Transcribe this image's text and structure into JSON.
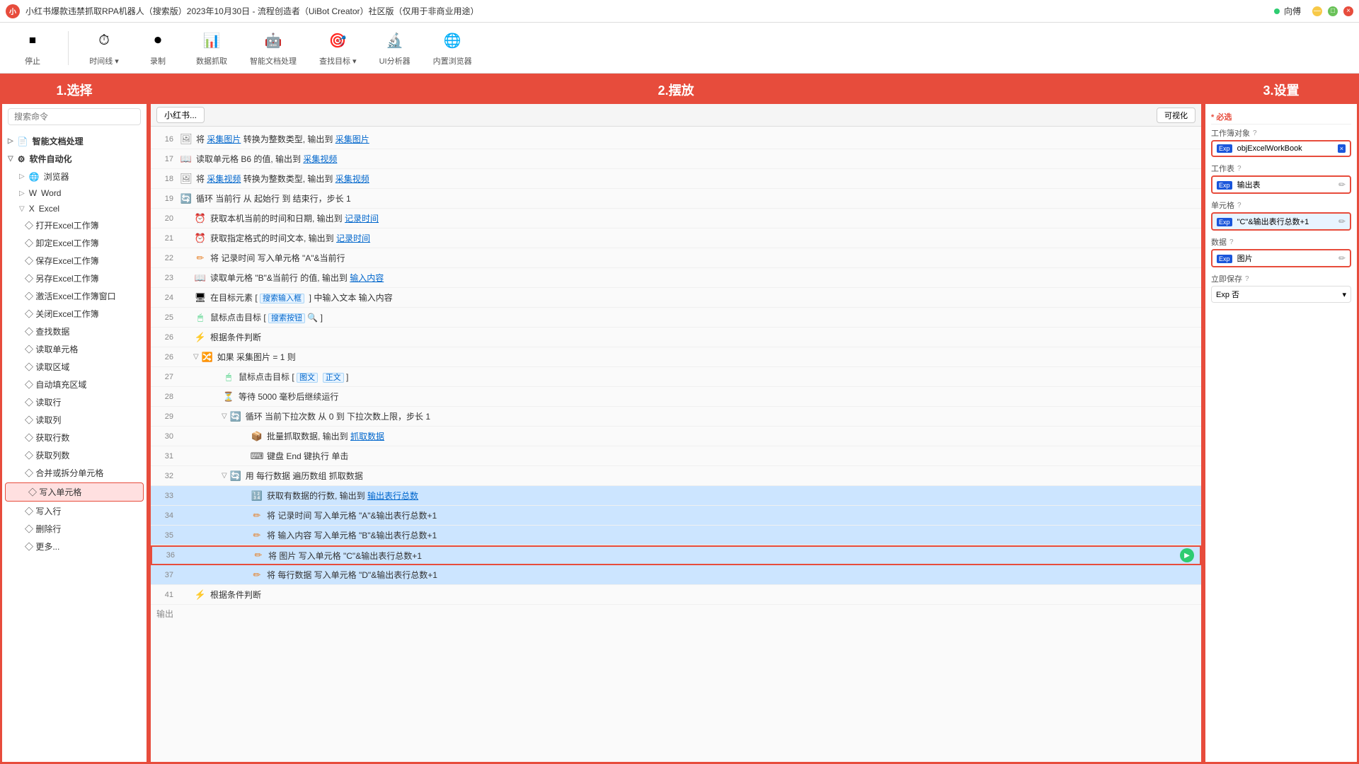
{
  "titleBar": {
    "icon": "小",
    "title": "小红书爆款违禁抓取RPA机器人（搜索版）2023年10月30日 - 流程创造者（UiBot Creator）社区版（仅用于非商业用途）",
    "user": "向傅",
    "windowControls": [
      "minimize",
      "maximize",
      "close"
    ]
  },
  "toolbar": {
    "buttons": [
      {
        "id": "stop",
        "icon": "⏹",
        "label": "停止"
      },
      {
        "id": "timeline",
        "icon": "⏱",
        "label": "时间线 ▾"
      },
      {
        "id": "record",
        "icon": "⏺",
        "label": "录制"
      },
      {
        "id": "dataExtract",
        "icon": "📊",
        "label": "数据抓取"
      },
      {
        "id": "aiDoc",
        "icon": "🤖",
        "label": "智能文档处理"
      },
      {
        "id": "findTarget",
        "icon": "🔍",
        "label": "查找目标 ▾"
      },
      {
        "id": "uiAnalyzer",
        "icon": "🔬",
        "label": "UI分析器"
      },
      {
        "id": "builtinBrowser",
        "icon": "🌐",
        "label": "内置浏览器"
      }
    ]
  },
  "panels": {
    "left": {
      "header": "1.选择",
      "searchPlaceholder": "搜索命令",
      "tree": [
        {
          "id": "智能文档处理",
          "label": "智能文档处理",
          "level": 1,
          "expanded": false,
          "icon": "📄"
        },
        {
          "id": "软件自动化",
          "label": "软件自动化",
          "level": 1,
          "expanded": true,
          "icon": "⚙"
        },
        {
          "id": "浏览器",
          "label": "浏览器",
          "level": 2,
          "expanded": false,
          "icon": "🌐"
        },
        {
          "id": "Word",
          "label": "Word",
          "level": 2,
          "expanded": false,
          "icon": "W"
        },
        {
          "id": "Excel",
          "label": "Excel",
          "level": 2,
          "expanded": true,
          "icon": "X"
        },
        {
          "id": "打开Excel工作簿",
          "label": "打开Excel工作簿",
          "level": 3
        },
        {
          "id": "卸定Excel工作簿",
          "label": "卸定Excel工作簿",
          "level": 3
        },
        {
          "id": "保存Excel工作簿",
          "label": "保存Excel工作簿",
          "level": 3
        },
        {
          "id": "另存Excel工作簿",
          "label": "另存Excel工作簿",
          "level": 3
        },
        {
          "id": "激活Excel工作簿窗口",
          "label": "激活Excel工作簿窗口",
          "level": 3
        },
        {
          "id": "关闭Excel工作簿",
          "label": "关闭Excel工作簿",
          "level": 3
        },
        {
          "id": "查找数据",
          "label": "查找数据",
          "level": 3
        },
        {
          "id": "读取单元格",
          "label": "读取单元格",
          "level": 3
        },
        {
          "id": "读取区域",
          "label": "读取区域",
          "level": 3
        },
        {
          "id": "自动填充区域",
          "label": "自动填充区域",
          "level": 3
        },
        {
          "id": "读取行",
          "label": "读取行",
          "level": 3
        },
        {
          "id": "读取列",
          "label": "读取列",
          "level": 3
        },
        {
          "id": "获取行数",
          "label": "获取行数",
          "level": 3
        },
        {
          "id": "获取列数",
          "label": "获取列数",
          "level": 3
        },
        {
          "id": "合并或拆分单元格",
          "label": "合并或拆分单元格",
          "level": 3
        },
        {
          "id": "写入单元格",
          "label": "写入单元格",
          "level": 3,
          "selected": true
        },
        {
          "id": "写入行",
          "label": "写入行",
          "level": 3
        },
        {
          "id": "删除行",
          "label": "删除行",
          "level": 3
        },
        {
          "id": "更多",
          "label": "更多",
          "level": 3
        }
      ]
    },
    "center": {
      "header": "2.摆放",
      "tabLabel": "小红书...",
      "visibleBtn": "可视化",
      "flowRows": [
        {
          "line": 16,
          "indent": 0,
          "icon": "img",
          "text": "将 采集图片 转换为整数类型, 输出到",
          "highlight": "采集图片",
          "type": "normal"
        },
        {
          "line": 17,
          "indent": 0,
          "icon": "read",
          "text": "读取单元格 B6 的值, 输出到",
          "highlight": "采集视频",
          "type": "normal"
        },
        {
          "line": 18,
          "indent": 0,
          "icon": "img",
          "text": "将 采集视频 转换为整数类型, 输出到",
          "highlight": "采集视频",
          "type": "normal"
        },
        {
          "line": 19,
          "indent": 0,
          "icon": "loop",
          "text": "循环 当前行 从 起始行 到 结束行，步长 1",
          "type": "loop"
        },
        {
          "line": 20,
          "indent": 1,
          "icon": "time",
          "text": "获取本机当前的时间和日期, 输出到",
          "highlight": "记录时间",
          "type": "normal"
        },
        {
          "line": 21,
          "indent": 1,
          "icon": "time",
          "text": "获取指定格式的时间文本, 输出到",
          "highlight": "记录时间",
          "type": "normal"
        },
        {
          "line": 22,
          "indent": 1,
          "icon": "write",
          "text": "将 记录时间 写入单元格 \"A\"&当前行",
          "type": "normal"
        },
        {
          "line": 23,
          "indent": 1,
          "icon": "read",
          "text": "读取单元格 \"B\"&当前行 的值, 输出到",
          "highlight": "输入内容",
          "type": "normal"
        },
        {
          "line": 24,
          "indent": 1,
          "icon": "square",
          "text": "在目标元素 [ 搜索输入框 ] 中输入文本 输入内容",
          "tag": "搜索输入框",
          "type": "normal"
        },
        {
          "line": 25,
          "indent": 1,
          "icon": "mouse",
          "text": "鼠标点击目标 [ 搜索按钮",
          "tag": "搜索按钮",
          "searchIcon": true,
          "type": "normal"
        },
        {
          "line": 26,
          "indent": 1,
          "icon": "cond",
          "text": "根据条件判断",
          "type": "cond"
        },
        {
          "line": "26b",
          "indent": 1,
          "icon": "if",
          "text": "如果 采集图片 = 1 则",
          "type": "if"
        },
        {
          "line": 27,
          "indent": 2,
          "icon": "mouse",
          "text": "鼠标点击目标 [ 图文",
          "tag2": "图文",
          "tag3": "正文",
          "type": "normal"
        },
        {
          "line": 28,
          "indent": 2,
          "icon": "wait",
          "text": "等待 5000 毫秒后继续运行",
          "type": "normal"
        },
        {
          "line": 29,
          "indent": 2,
          "icon": "loop",
          "text": "循环 当前下拉次数 从 0 到 下拉次数上限，步长 1",
          "type": "loop"
        },
        {
          "line": 30,
          "indent": 3,
          "icon": "batch",
          "text": "批量抓取数据, 输出到",
          "highlight": "抓取数据",
          "type": "normal"
        },
        {
          "line": 31,
          "indent": 3,
          "icon": "key",
          "text": "键盘 End 键执行 单击",
          "type": "normal"
        },
        {
          "line": 32,
          "indent": 2,
          "icon": "loop",
          "text": "用 每行数据 遍历数组 抓取数据",
          "type": "loop"
        },
        {
          "line": 33,
          "indent": 3,
          "icon": "calc",
          "text": "获取有数据的行数, 输出到",
          "highlight": "输出表行总数",
          "type": "normal"
        },
        {
          "line": 34,
          "indent": 3,
          "icon": "write",
          "text": "将 记录时间 写入单元格 \"A\"&输出表行总数+1",
          "type": "normal"
        },
        {
          "line": 35,
          "indent": 3,
          "icon": "write",
          "text": "将 输入内容 写入单元格 \"B\"&输出表行总数+1",
          "type": "normal"
        },
        {
          "line": 36,
          "indent": 3,
          "icon": "write",
          "text": "将 图片 写入单元格 \"C\"&输出表行总数+1",
          "type": "selected",
          "selected": true
        },
        {
          "line": 37,
          "indent": 3,
          "icon": "write",
          "text": "将 每行数据 写入单元格 \"D\"&输出表行总数+1",
          "type": "normal"
        },
        {
          "line": 41,
          "indent": 1,
          "icon": "cond",
          "text": "根据条件判断",
          "type": "cond"
        }
      ],
      "outputLabel": "输出"
    },
    "right": {
      "header": "3.设置",
      "sections": [
        {
          "label": "* 必选",
          "fields": [
            {
              "label": "工作簿对象",
              "hint": "?",
              "type": "tag-close",
              "expTag": "Exp",
              "value": "objExcelWorkBook",
              "closeBtn": "×"
            },
            {
              "label": "工作表",
              "hint": "?",
              "type": "exp-edit",
              "expTag": "Exp",
              "value": "输出表",
              "editIcon": "✏"
            },
            {
              "label": "单元格",
              "hint": "?",
              "type": "exp-edit-red",
              "expTag": "Exp",
              "value": "\"C\"&输出表行总数+1",
              "editIcon": "✏"
            },
            {
              "label": "数据",
              "hint": "?",
              "type": "exp-edit",
              "expTag": "Exp",
              "value": "图片",
              "editIcon": "✏"
            },
            {
              "label": "立即保存",
              "hint": "?",
              "type": "select",
              "expTag": "Exp",
              "value": "否"
            }
          ]
        }
      ]
    }
  }
}
